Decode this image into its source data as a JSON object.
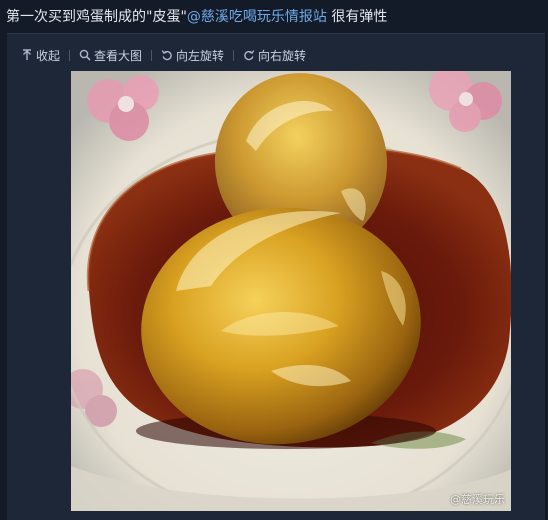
{
  "post": {
    "text_before": "第一次买到鸡蛋制成的\"皮蛋\"",
    "mention": "@慈溪吃喝玩乐情报站",
    "text_after": " 很有弹性"
  },
  "toolbar": {
    "collapse_label": "收起",
    "view_large_label": "查看大图",
    "rotate_left_label": "向左旋转",
    "rotate_right_label": "向右旋转"
  },
  "photo": {
    "watermark": "@慈溪玩乐"
  },
  "colors": {
    "mention": "#6fa8e6",
    "background": "#131b29",
    "card": "#1d2738"
  }
}
